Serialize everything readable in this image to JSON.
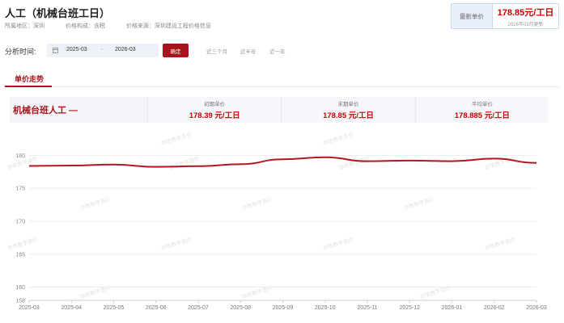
{
  "header": {
    "title": "人工（机械台班工日）",
    "meta": [
      "所属地区：深圳",
      "价格构成：含税",
      "价格来源：深圳建设工程价格信息"
    ],
    "latest_label": "最新单价",
    "latest_price": "178.85元/工日",
    "latest_update": "2026年03月更新"
  },
  "analysis": {
    "label": "分析时间:",
    "start": "2025-03",
    "separator": "-",
    "end": "2026-03",
    "confirm_label": "确定",
    "quick_options": [
      "近三个月",
      "近半年",
      "近一年"
    ]
  },
  "tabs": {
    "active": "单价走势"
  },
  "summary": {
    "name": "机械台班人工 —",
    "items": [
      {
        "label": "初期单价",
        "value": "178.39 元/工日"
      },
      {
        "label": "末期单价",
        "value": "178.85 元/工日"
      },
      {
        "label": "平均单价",
        "value": "178.885 元/工日"
      }
    ]
  },
  "watermark": "华筑数字造价",
  "chart_data": {
    "type": "line",
    "categories": [
      "2025-03",
      "2025-04",
      "2025-05",
      "2025-06",
      "2025-07",
      "2025-08",
      "2025-09",
      "2025-10",
      "2025-11",
      "2025-12",
      "2026-01",
      "2026-02",
      "2026-03"
    ],
    "series": [
      {
        "values": [
          178.39,
          178.45,
          178.6,
          178.25,
          178.35,
          178.65,
          179.4,
          179.7,
          179.1,
          179.2,
          179.1,
          179.5,
          178.85
        ],
        "color": "#b3161c"
      }
    ],
    "y_ticks": [
      158,
      160,
      165,
      170,
      175,
      180
    ],
    "ylim": [
      158,
      182
    ],
    "grid": true
  }
}
